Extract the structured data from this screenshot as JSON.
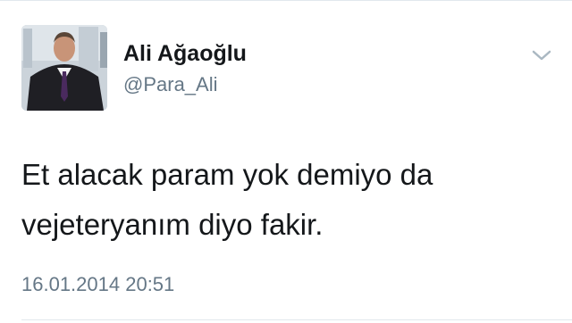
{
  "tweet": {
    "author_name": "Ali Ağaoğlu",
    "handle": "@Para_Ali",
    "text": "Et alacak param yok demiyo da vejeteryanım diyo fakir.",
    "timestamp": "16.01.2014 20:51"
  },
  "icons": {
    "menu": "chevron-down-icon",
    "avatar": "profile-photo"
  },
  "colors": {
    "primary_text": "#14171a",
    "secondary_text": "#657786",
    "divider": "#e1e8ed",
    "chevron": "#aab8c2"
  }
}
